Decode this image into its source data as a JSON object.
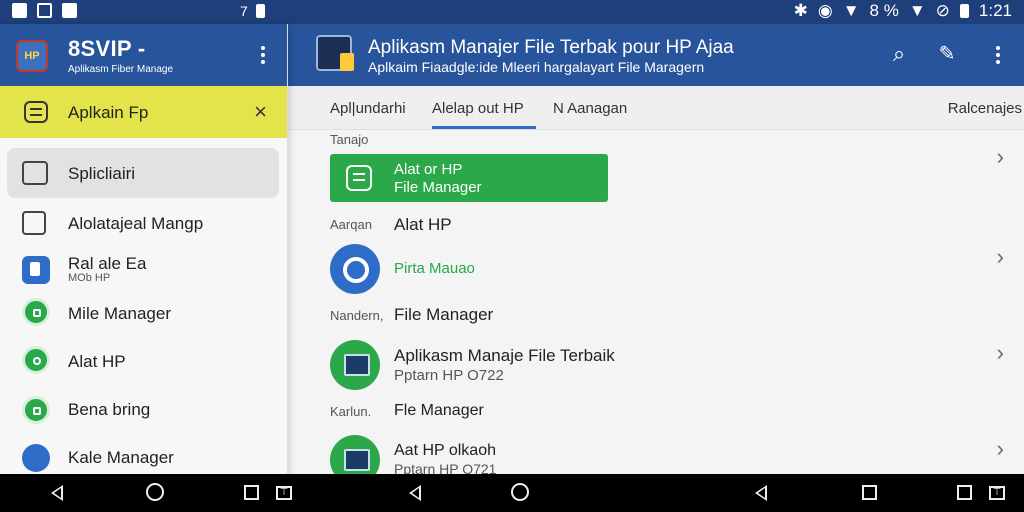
{
  "status_bar": {
    "left_text": "7",
    "battery_percent_text": "8 %",
    "time": "1:21"
  },
  "drawer": {
    "app_name": "8SVIP -",
    "app_subtitle": "Aplikasm Fiber Manage",
    "banner": {
      "label": "Aplkain Fp"
    },
    "items": [
      {
        "label": "Splicliairi",
        "icon": "folder-icon"
      },
      {
        "label": "Alolatajeal Mangp",
        "icon": "file-icon"
      },
      {
        "label": "Ral ale Ea",
        "sub": "MOb HP",
        "icon": "document-icon"
      },
      {
        "label": "Mile Manager",
        "icon": "square-app-icon"
      },
      {
        "label": "Alat HP",
        "icon": "sync-icon"
      },
      {
        "label": "Bena bring",
        "icon": "grid-app-icon"
      },
      {
        "label": "Kale Manager",
        "icon": "calendar-app-icon"
      }
    ]
  },
  "topbar": {
    "title": "Aplikasm Manajer File Terbak pour HP Ajaa",
    "subtitle": "Aplkaim Fiaadgle:ide Mleeri hargalayart File Maragern"
  },
  "tabs": [
    {
      "label": "Apl|undarhi"
    },
    {
      "label": "Alelap out HP"
    },
    {
      "label": "N Aanagan"
    },
    {
      "label": "Ralcenajes"
    }
  ],
  "content": {
    "section1_label": "Tanajo",
    "highlight_line1": "Alat or HP",
    "highlight_line2": "File Manager",
    "section2_label": "Aarqan",
    "section2_title": "Alat HP",
    "item1_title": "Pirta Mauao",
    "section3_label": "Nandern,",
    "section3_title": "File Manager",
    "item2_title": "Aplikasm Manaje File Terbaik",
    "item2_sub": "Pptarn HP O722",
    "section4_label": "Karlun.",
    "section4_title": "Fle Manager",
    "item3_title": "Aat HP olkaoh",
    "item3_sub": "Pptarn HP O721"
  },
  "colors": {
    "header_blue": "#27549a",
    "status_blue": "#1e3f7a",
    "banner_yellow": "#e3e44a",
    "accent_green": "#2aa84a",
    "accent_blue": "#2e6cc7"
  }
}
